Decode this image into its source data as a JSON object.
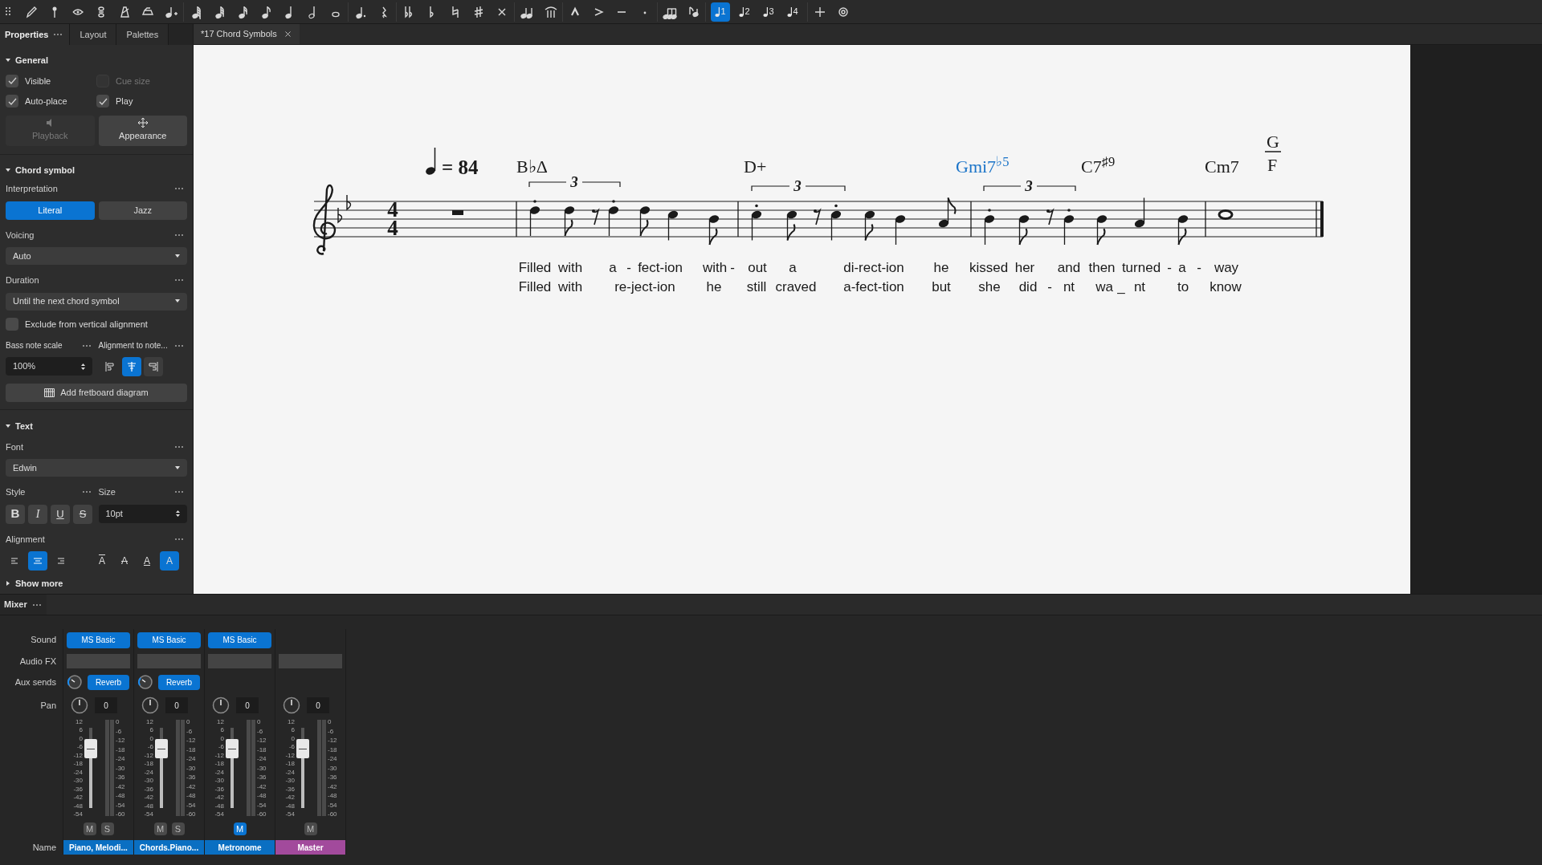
{
  "toolbar": {
    "voices": [
      {
        "label": "1",
        "selected": true
      },
      {
        "label": "2",
        "selected": false
      },
      {
        "label": "3",
        "selected": false
      },
      {
        "label": "4",
        "selected": false
      }
    ]
  },
  "panel_tabs": [
    {
      "label": "Properties",
      "selected": true
    },
    {
      "label": "Layout",
      "selected": false
    },
    {
      "label": "Palettes",
      "selected": false
    }
  ],
  "document_tab": {
    "title": "*17 Chord Symbols"
  },
  "properties": {
    "general": {
      "title": "General",
      "expanded": true,
      "checkboxes": [
        {
          "label": "Visible",
          "checked": true,
          "disabled": false
        },
        {
          "label": "Cue size",
          "checked": false,
          "disabled": true
        },
        {
          "label": "Auto-place",
          "checked": true,
          "disabled": false
        },
        {
          "label": "Play",
          "checked": true,
          "disabled": false
        }
      ],
      "buttons": [
        {
          "label": "Playback",
          "kind": "playback",
          "disabled": true
        },
        {
          "label": "Appearance",
          "kind": "appearance",
          "disabled": false
        }
      ]
    },
    "chord_symbol": {
      "title": "Chord symbol",
      "expanded": true,
      "interpretation": {
        "label": "Interpretation",
        "options": [
          {
            "label": "Literal",
            "selected": true
          },
          {
            "label": "Jazz",
            "selected": false
          }
        ]
      },
      "voicing": {
        "label": "Voicing",
        "value": "Auto"
      },
      "duration": {
        "label": "Duration",
        "value": "Until the next chord symbol"
      },
      "exclude": {
        "label": "Exclude from vertical alignment",
        "checked": false
      },
      "bass_note_scale": {
        "label": "Bass note scale",
        "value": "100%"
      },
      "alignment_to_notehead": {
        "label": "Alignment to note...",
        "options": [
          {
            "selected": false
          },
          {
            "selected": true
          },
          {
            "selected": false
          }
        ]
      },
      "fretboard_button": {
        "label": "Add fretboard diagram"
      }
    },
    "text": {
      "title": "Text",
      "expanded": true,
      "font": {
        "label": "Font",
        "value": "Edwin"
      },
      "style": {
        "label": "Style",
        "buttons": [
          {
            "label": "B",
            "kind": "bold",
            "selected": false
          },
          {
            "label": "I",
            "kind": "italic",
            "selected": false
          },
          {
            "label": "U",
            "kind": "underline",
            "selected": false
          },
          {
            "label": "S",
            "kind": "strike",
            "selected": false
          }
        ]
      },
      "size": {
        "label": "Size",
        "value": "10pt"
      },
      "alignment": {
        "label": "Alignment",
        "horizontal": [
          {
            "selected": false
          },
          {
            "selected": true
          },
          {
            "selected": false
          }
        ],
        "vertical": [
          {
            "label": "A",
            "kind": "top",
            "selected": false
          },
          {
            "label": "A",
            "kind": "middle",
            "selected": false
          },
          {
            "label": "A",
            "kind": "baseline",
            "selected": false
          },
          {
            "label": "A",
            "kind": "bottom",
            "selected": true
          }
        ]
      }
    },
    "show_more": {
      "label": "Show more",
      "expanded": false
    }
  },
  "score": {
    "tempo": "= 84",
    "time_signature": {
      "numerator": "4",
      "denominator": "4"
    },
    "chords": [
      {
        "text": "B♭Δ",
        "selected": false
      },
      {
        "text": "D+",
        "selected": false
      },
      {
        "text": "Gmi7$^{♭5}$",
        "selected": true
      },
      {
        "text": "C7$^{♯9}$",
        "selected": false
      },
      {
        "text": "Cm7",
        "selected": false
      }
    ],
    "slash_chord": {
      "top": "G",
      "bottom": "F",
      "selected": false
    },
    "tuplets": [
      "3",
      "3",
      "3"
    ],
    "lyrics": [
      [
        "Filled",
        "with",
        "a",
        "-",
        "fect-ion",
        "with",
        "-",
        "out",
        "a",
        "di-rect-ion",
        "he",
        "kissed",
        "her",
        "and",
        "then",
        "turned",
        "-",
        "a",
        "-",
        "way"
      ],
      [
        "Filled",
        "with",
        "re-ject-ion",
        "he",
        "still",
        "craved",
        "a-fect-tion",
        "but",
        "she",
        "did",
        "-",
        "nt",
        "wa",
        "_",
        "nt",
        "to",
        "know"
      ]
    ]
  },
  "mixer": {
    "title": "Mixer",
    "row_labels": {
      "sound": "Sound",
      "audio_fx": "Audio FX",
      "aux_sends": "Aux sends",
      "pan": "Pan",
      "name": "Name"
    },
    "channels": [
      {
        "name": "Piano, Melodi...",
        "sound": "MS Basic",
        "aux": "Reverb",
        "pan": "0",
        "level": 0.74,
        "mute_label": "M",
        "muted": false,
        "solo_label": "S",
        "soloed": false,
        "color": "#0a6fc2",
        "fader_scale": [
          "12",
          "6",
          "0",
          "-6",
          "-12",
          "-18",
          "-24",
          "-30",
          "-36",
          "-42",
          "-48",
          "-54"
        ],
        "meter_scale": [
          "0",
          "-6",
          "-12",
          "-18",
          "-24",
          "-30",
          "-36",
          "-42",
          "-48",
          "-54",
          "-60"
        ]
      },
      {
        "name": "Chords.Piano...",
        "sound": "MS Basic",
        "aux": "Reverb",
        "pan": "0",
        "level": 0.74,
        "mute_label": "M",
        "muted": false,
        "solo_label": "S",
        "soloed": false,
        "color": "#0a6fc2",
        "fader_scale": [
          "12",
          "6",
          "0",
          "-6",
          "-12",
          "-18",
          "-24",
          "-30",
          "-36",
          "-42",
          "-48",
          "-54"
        ],
        "meter_scale": [
          "0",
          "-6",
          "-12",
          "-18",
          "-24",
          "-30",
          "-36",
          "-42",
          "-48",
          "-54",
          "-60"
        ]
      },
      {
        "name": "Metronome",
        "sound": "MS Basic",
        "pan": "0",
        "level": 0.74,
        "mute_label": "M",
        "muted": true,
        "color": "#0a6fc2",
        "fader_scale": [
          "12",
          "6",
          "0",
          "-6",
          "-12",
          "-18",
          "-24",
          "-30",
          "-36",
          "-42",
          "-48",
          "-54"
        ],
        "meter_scale": [
          "0",
          "-6",
          "-12",
          "-18",
          "-24",
          "-30",
          "-36",
          "-42",
          "-48",
          "-54",
          "-60"
        ]
      },
      {
        "name": "Master",
        "pan": "0",
        "level": 0.74,
        "mute_label": "M",
        "muted": false,
        "color": "#a24a9c",
        "fader_scale": [
          "12",
          "6",
          "0",
          "-6",
          "-12",
          "-18",
          "-24",
          "-30",
          "-36",
          "-42",
          "-48",
          "-54"
        ],
        "meter_scale": [
          "0",
          "-6",
          "-12",
          "-18",
          "-24",
          "-30",
          "-36",
          "-42",
          "-48",
          "-54",
          "-60"
        ]
      }
    ]
  }
}
